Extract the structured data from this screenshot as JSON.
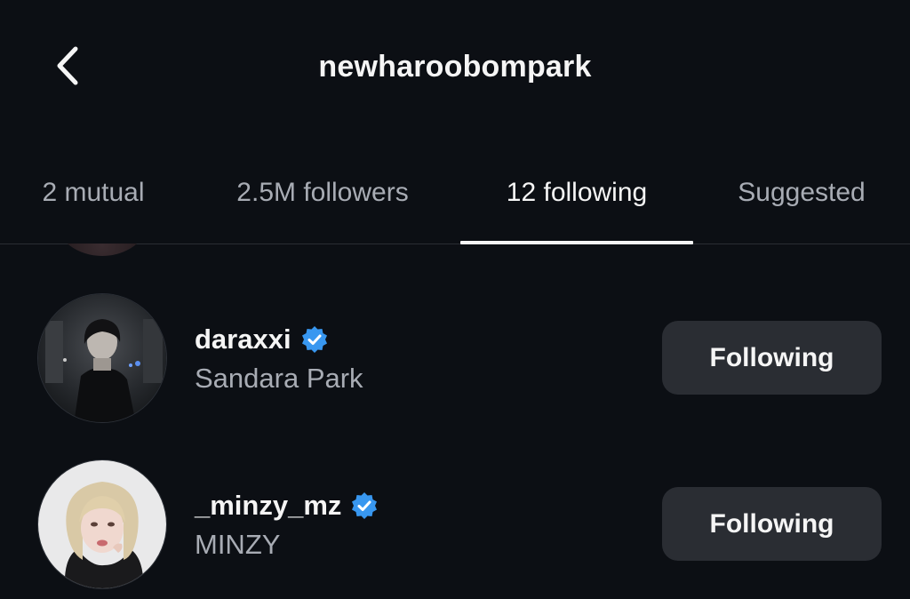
{
  "header": {
    "title": "newharoobompark",
    "back_icon": "chevron-left-icon"
  },
  "tabs": [
    {
      "label": "2 mutual",
      "active": false
    },
    {
      "label": "2.5M followers",
      "active": false
    },
    {
      "label": "12 following",
      "active": true
    },
    {
      "label": "Suggested",
      "active": false
    }
  ],
  "list": [
    {
      "username": "daraxxi",
      "full_name": "Sandara Park",
      "verified": true,
      "button_label": "Following"
    },
    {
      "username": "_minzy_mz",
      "full_name": "MINZY",
      "verified": true,
      "button_label": "Following"
    }
  ],
  "colors": {
    "background": "#0c0f14",
    "button": "#2a2d33",
    "verified": "#3897f0",
    "secondary_text": "#a8acb4"
  }
}
